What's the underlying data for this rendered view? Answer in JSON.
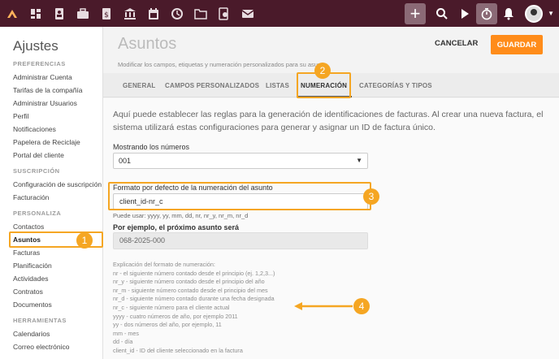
{
  "topbar": {
    "left_icons": [
      "logo-icon",
      "dashboard-icon",
      "contacts-icon",
      "briefcase-icon",
      "invoice-icon",
      "bank-icon",
      "calendar-icon",
      "history-icon",
      "folder-icon",
      "document-search-icon",
      "mail-icon"
    ],
    "plus_label": "+"
  },
  "sidebar": {
    "title": "Ajustes",
    "sections": [
      {
        "heading": "PREFERENCIAS",
        "items": [
          "Administrar Cuenta",
          "Tarifas de la compañía",
          "Administrar Usuarios",
          "Perfil",
          "Notificaciones",
          "Papelera de Reciclaje",
          "Portal del cliente"
        ]
      },
      {
        "heading": "SUSCRIPCIÓN",
        "items": [
          "Configuración de suscripción",
          "Facturación"
        ]
      },
      {
        "heading": "PERSONALIZA",
        "items": [
          "Contactos",
          "Asuntos",
          "Facturas",
          "Planificación",
          "Actividades",
          "Contratos",
          "Documentos"
        ]
      },
      {
        "heading": "HERRAMIENTAS",
        "items": [
          "Calendarios",
          "Correo electrónico"
        ]
      }
    ]
  },
  "header": {
    "title": "Asuntos",
    "subtitle": "Modificar los campos, etiquetas y numeración personalizados para su asunto",
    "cancel_label": "CANCELAR",
    "save_label": "GUARDAR"
  },
  "tabs": [
    "GENERAL",
    "CAMPOS PERSONALIZADOS",
    "LISTAS",
    "NUMERACIÓN",
    "CATEGORÍAS Y TIPOS"
  ],
  "content": {
    "description": "Aquí puede establecer las reglas para la generación de identificaciones de facturas. Al crear una nueva factura, el sistema utilizará estas configuraciones para generar y asignar un ID de factura único.",
    "digits_label": "Mostrando los números",
    "digits_value": "001",
    "format_label": "Formato por defecto de la numeración del asunto",
    "format_value": "client_id-nr_c",
    "hint": "Puede usar: yyyy, yy, mm, dd, nr, nr_y, nr_m, nr_d",
    "example_label": "Por ejemplo, el próximo asunto será",
    "example_value": "068-2025-000",
    "explanation": [
      "Explicación del formato de numeración:",
      "nr - el siguiente número contado desde el principio (ej. 1,2,3...)",
      "nr_y - siguiente número contado desde el principio del año",
      "nr_m - siguiente número contado desde el principio del mes",
      "nr_d - siguiente número contado durante una fecha designada",
      "nr_c - siguiente número para el cliente actual",
      "yyyy - cuatro números de año, por ejemplo 2011",
      "yy - dos números del año, por ejemplo, 11",
      "mm - mes",
      "dd - día",
      "client_id - ID del cliente seleccionado en la factura"
    ]
  },
  "annotations": [
    "1",
    "2",
    "3",
    "4"
  ],
  "colors": {
    "topbar": "#4a1a2a",
    "accent": "#ff8c1a",
    "highlight": "#f5a623"
  }
}
